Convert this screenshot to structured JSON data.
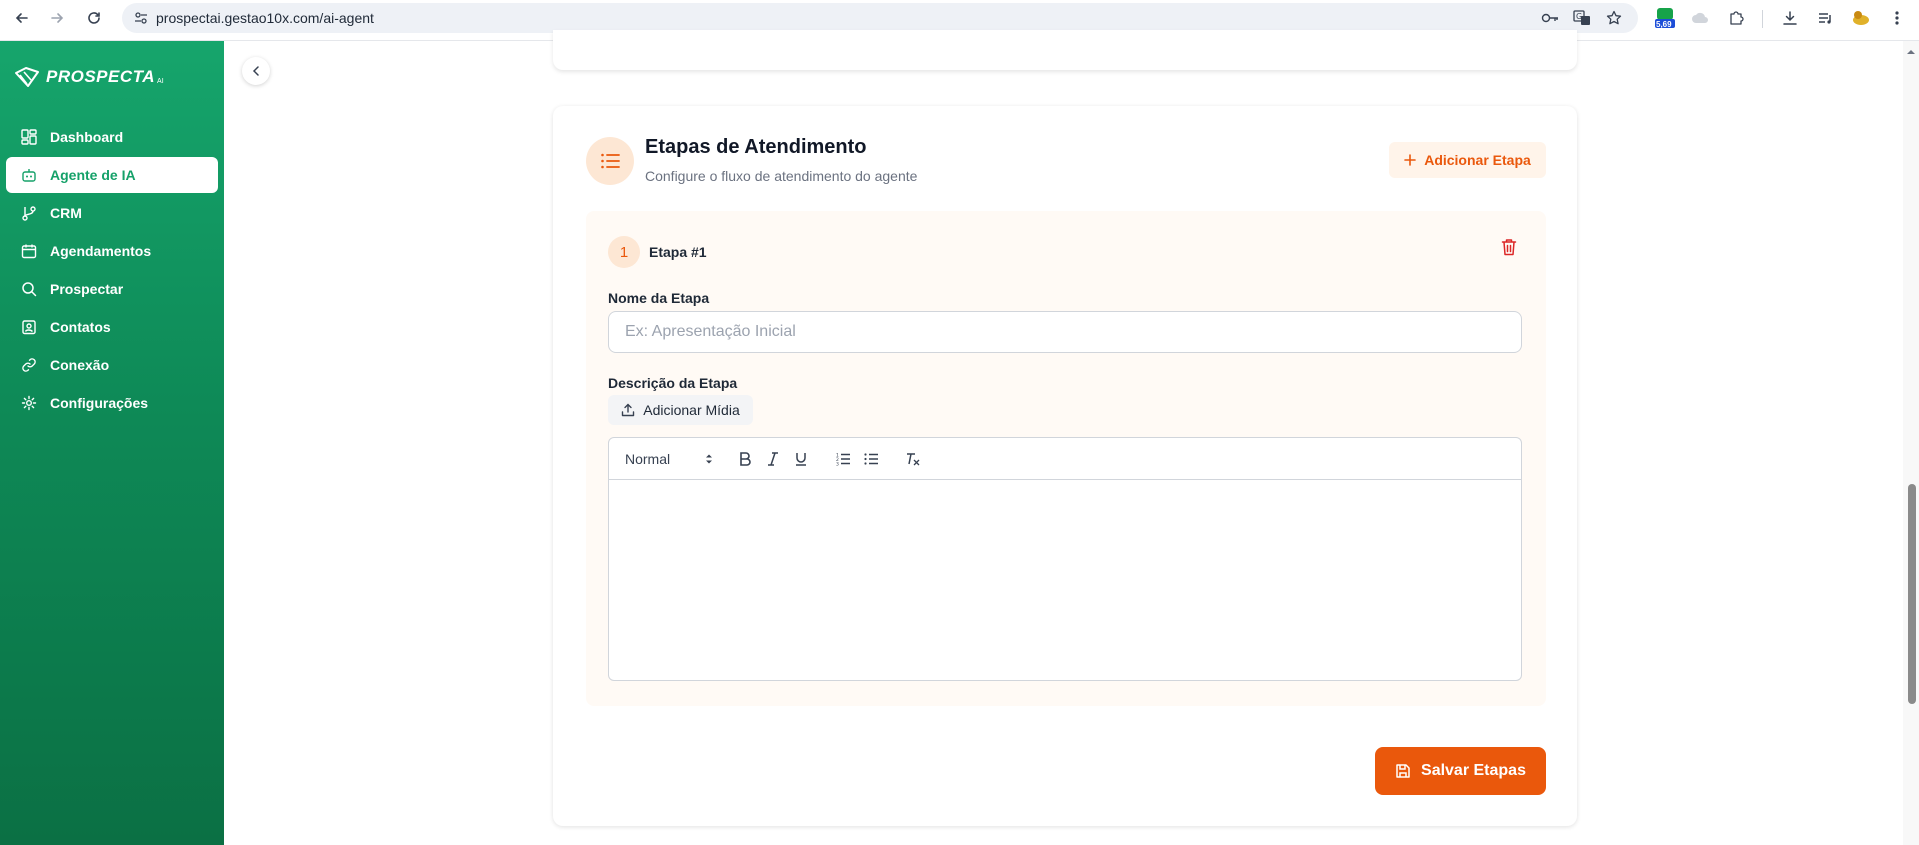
{
  "browser": {
    "url": "prospectai.gestao10x.com/ai-agent",
    "extension_badge": "5,69"
  },
  "sidebar": {
    "logo_text": "PROSPECTA",
    "logo_sub": "AI",
    "items": [
      {
        "label": "Dashboard",
        "icon": "dashboard-icon"
      },
      {
        "label": "Agente de IA",
        "icon": "bot-icon",
        "active": true
      },
      {
        "label": "CRM",
        "icon": "git-branch-icon"
      },
      {
        "label": "Agendamentos",
        "icon": "calendar-icon"
      },
      {
        "label": "Prospectar",
        "icon": "search-icon"
      },
      {
        "label": "Contatos",
        "icon": "contact-icon"
      },
      {
        "label": "Conexão",
        "icon": "link-icon"
      },
      {
        "label": "Configurações",
        "icon": "settings-icon"
      }
    ]
  },
  "section": {
    "title": "Etapas de Atendimento",
    "subtitle": "Configure o fluxo de atendimento do agente",
    "add_button": "Adicionar Etapa"
  },
  "step": {
    "number": "1",
    "label": "Etapa #1",
    "name_label": "Nome da Etapa",
    "name_placeholder": "Ex: Apresentação Inicial",
    "name_value": "",
    "description_label": "Descrição da Etapa",
    "media_button": "Adicionar Mídia",
    "format_select": "Normal"
  },
  "save_button": "Salvar Etapas",
  "colors": {
    "accent": "#ea580c",
    "sidebar": "#16a56c",
    "accent_soft": "#fde7d4"
  }
}
